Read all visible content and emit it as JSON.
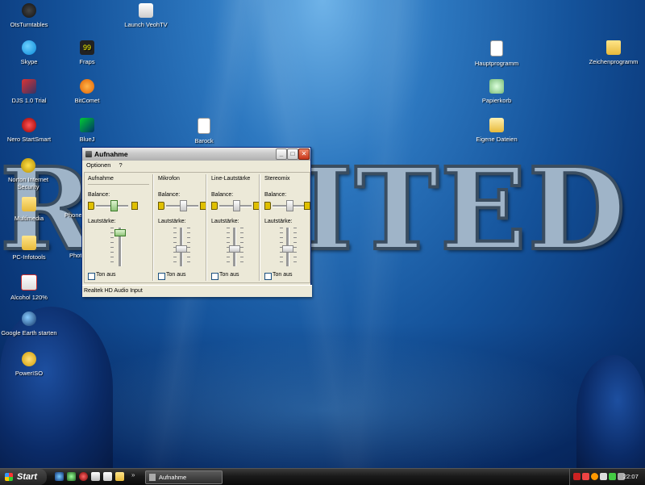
{
  "desktop": {
    "wallpaper_text": "RONITED",
    "icons": [
      {
        "label": "OtsTurntables",
        "x": 0
      },
      {
        "label": "Skype"
      },
      {
        "label": "DJS 1.0 Trial"
      },
      {
        "label": "Nero StartSmart"
      },
      {
        "label": "Norton Internet Security"
      },
      {
        "label": "Multimedia"
      },
      {
        "label": "PC-Infotools"
      },
      {
        "label": "Alcohol 120%"
      },
      {
        "label": "Google Earth starten"
      },
      {
        "label": "PowerISO"
      },
      {
        "label": "Launch VeohTV"
      },
      {
        "label": "Fraps"
      },
      {
        "label": "BitComet"
      },
      {
        "label": "BlueJ"
      },
      {
        "label": "Phone"
      },
      {
        "label": "Photo"
      },
      {
        "label": "Barock"
      },
      {
        "label": "Hauptprogramm"
      },
      {
        "label": "Papierkorb"
      },
      {
        "label": "Eigene Dateien"
      },
      {
        "label": "Zeichenprogramm"
      }
    ]
  },
  "window": {
    "title": "Aufnahme",
    "menu": [
      "Optionen",
      "?"
    ],
    "status": "Realtek HD Audio Input",
    "balance_label": "Balance:",
    "volume_label": "Lautstärke:",
    "mute_label": "Ton aus",
    "channels": [
      {
        "name": "Aufnahme",
        "balance": 0.5,
        "volume": 0.95,
        "muted": false,
        "active": true
      },
      {
        "name": "Mikrofon",
        "balance": 0.5,
        "volume": 0.55,
        "muted": false,
        "active": false
      },
      {
        "name": "Line-Lautstärke",
        "balance": 0.5,
        "volume": 0.55,
        "muted": false,
        "active": false
      },
      {
        "name": "Stereomix",
        "balance": 0.5,
        "volume": 0.55,
        "muted": false,
        "active": false
      }
    ]
  },
  "taskbar": {
    "start_label": "Start",
    "tasks": [
      {
        "label": "Aufnahme"
      }
    ],
    "clock": "22:07"
  }
}
